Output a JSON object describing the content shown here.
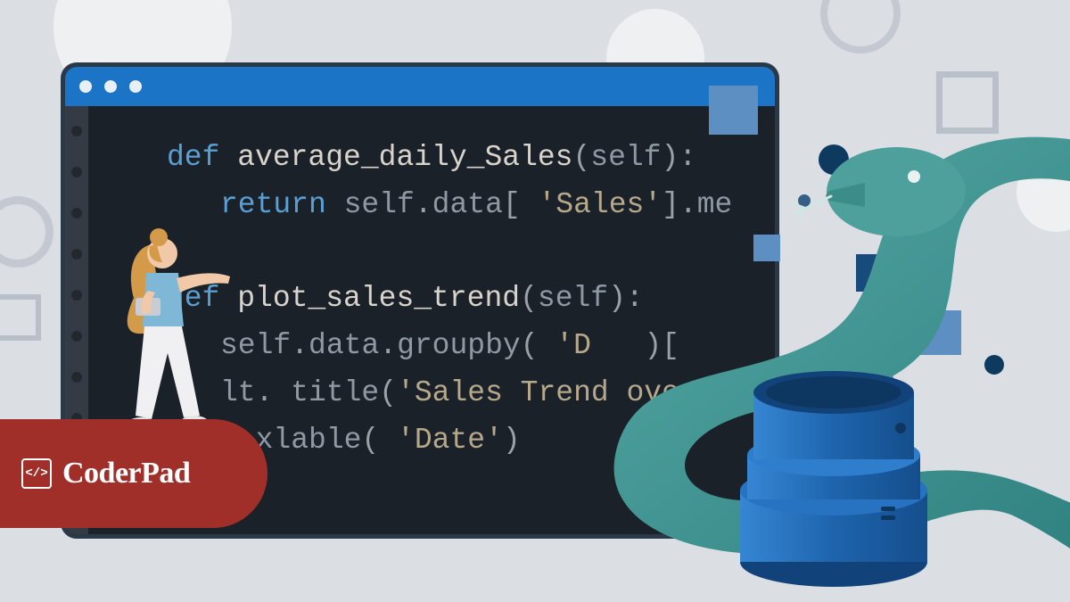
{
  "brand": {
    "name": "CoderPad",
    "icon_glyph": "</>"
  },
  "editor": {
    "lines": [
      {
        "indent": 1,
        "tokens": [
          {
            "t": "kw",
            "v": "def "
          },
          {
            "t": "fn",
            "v": "average_daily_Sales"
          },
          {
            "t": "punct",
            "v": "("
          },
          {
            "t": "id",
            "v": "self"
          },
          {
            "t": "punct",
            "v": "):"
          }
        ]
      },
      {
        "indent": 2,
        "tokens": [
          {
            "t": "kw",
            "v": "return "
          },
          {
            "t": "id",
            "v": "self"
          },
          {
            "t": "punct",
            "v": "."
          },
          {
            "t": "id",
            "v": "data"
          },
          {
            "t": "punct",
            "v": "[ "
          },
          {
            "t": "str",
            "v": "'Sales'"
          },
          {
            "t": "punct",
            "v": "]."
          },
          {
            "t": "id",
            "v": "me"
          }
        ]
      },
      {
        "indent": 0,
        "tokens": [
          {
            "t": "id",
            "v": " "
          }
        ]
      },
      {
        "indent": 1,
        "tokens": [
          {
            "t": "kw",
            "v": "def "
          },
          {
            "t": "fn",
            "v": "plot_sales_trend"
          },
          {
            "t": "punct",
            "v": "("
          },
          {
            "t": "id",
            "v": "self"
          },
          {
            "t": "punct",
            "v": "):"
          }
        ]
      },
      {
        "indent": 2,
        "tokens": [
          {
            "t": "id",
            "v": "self"
          },
          {
            "t": "punct",
            "v": "."
          },
          {
            "t": "id",
            "v": "data"
          },
          {
            "t": "punct",
            "v": "."
          },
          {
            "t": "id",
            "v": "groupby"
          },
          {
            "t": "punct",
            "v": "( "
          },
          {
            "t": "str",
            "v": "'D"
          },
          {
            "t": "punct",
            "v": "   )["
          }
        ]
      },
      {
        "indent": 2,
        "tokens": [
          {
            "t": "id",
            "v": "lt"
          },
          {
            "t": "punct",
            "v": ". "
          },
          {
            "t": "id",
            "v": "title"
          },
          {
            "t": "punct",
            "v": "("
          },
          {
            "t": "str",
            "v": "'Sales Trend ove"
          }
        ]
      },
      {
        "indent": 2,
        "tokens": [
          {
            "t": "punct",
            "v": ". "
          },
          {
            "t": "id",
            "v": "xlable"
          },
          {
            "t": "punct",
            "v": "( "
          },
          {
            "t": "str",
            "v": "'Date'"
          },
          {
            "t": "punct",
            "v": ")"
          }
        ]
      }
    ]
  },
  "colors": {
    "bg": "#dbdee3",
    "editor_bg": "#1b2128",
    "titlebar": "#1b74c5",
    "kw": "#5a9fd4",
    "badge": "#a02f29",
    "snake": "#459d9a",
    "db_light": "#2f7fcf",
    "db_dark": "#1b5ea6"
  }
}
